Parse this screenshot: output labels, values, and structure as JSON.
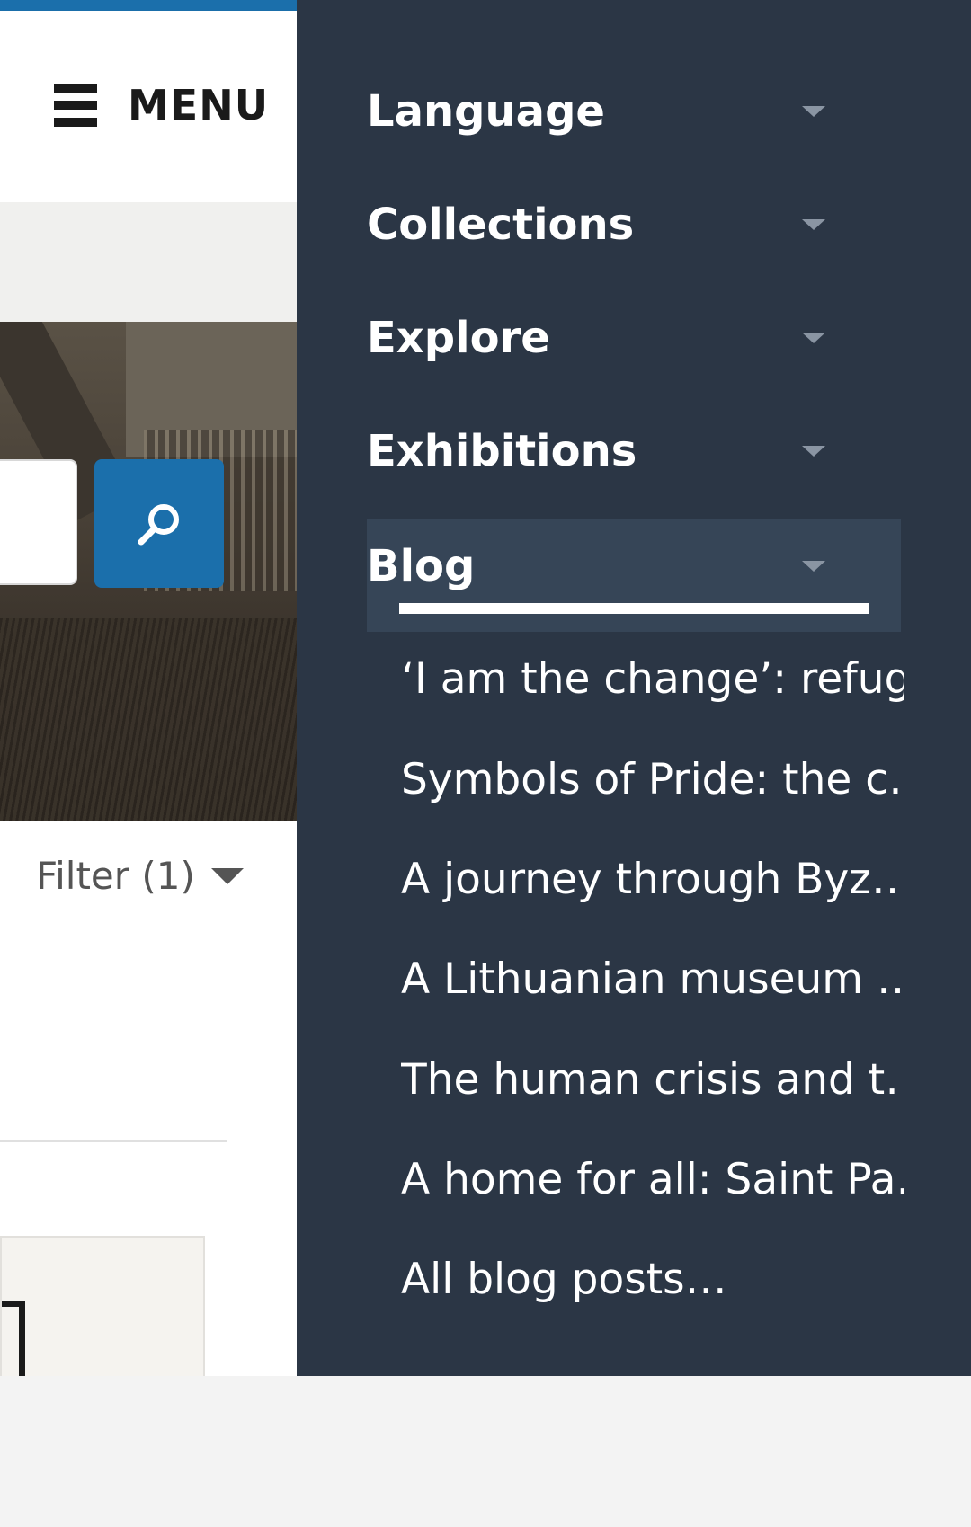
{
  "header": {
    "menu_label": "MENU"
  },
  "filter": {
    "label": "Filter (1)"
  },
  "nav": {
    "items": [
      {
        "label": "Language"
      },
      {
        "label": "Collections"
      },
      {
        "label": "Explore"
      },
      {
        "label": "Exhibitions"
      },
      {
        "label": "Blog"
      }
    ],
    "blog_posts": [
      {
        "label": "‘I am the change’: refug…"
      },
      {
        "label": "Symbols of Pride: the c…"
      },
      {
        "label": "A journey through Byz…"
      },
      {
        "label": "A Lithuanian museum …"
      },
      {
        "label": "The human crisis and t…"
      },
      {
        "label": "A home for all: Saint Pa…"
      },
      {
        "label": "All blog posts…"
      }
    ]
  },
  "colors": {
    "accent": "#1b6fab",
    "drawer_bg": "#2b3645",
    "active_item_bg": "#364557"
  }
}
